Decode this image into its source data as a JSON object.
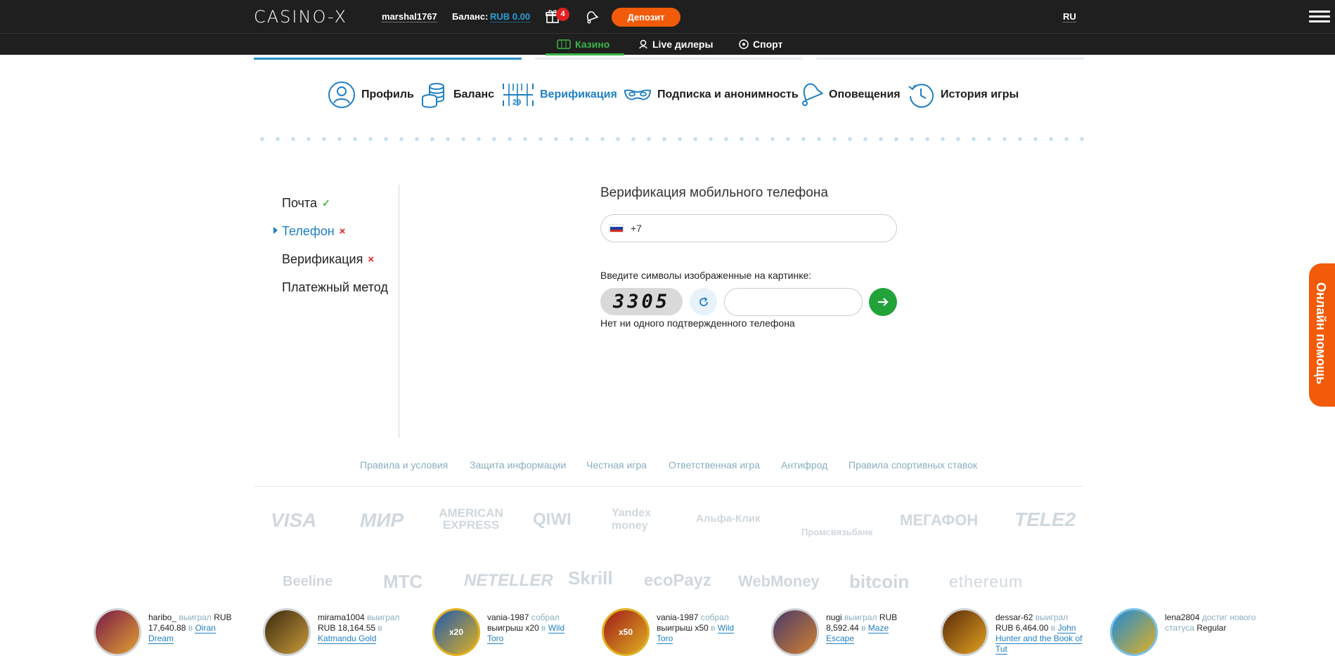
{
  "header": {
    "logo": "CASINO-X",
    "username": "marshal1767",
    "balance_label": "Баланс:",
    "balance_value": "RUB 0.00",
    "gift_count": "4",
    "deposit_label": "Депозит",
    "language": "RU"
  },
  "subnav": {
    "items": [
      {
        "label": "Казино",
        "icon": "slot-icon",
        "active": true
      },
      {
        "label": "Live дилеры",
        "icon": "dealer-icon",
        "active": false
      },
      {
        "label": "Спорт",
        "icon": "ball-icon",
        "active": false
      }
    ]
  },
  "profile_tabs": [
    {
      "label": "Профиль",
      "icon": "profile-icon",
      "active": false
    },
    {
      "label": "Баланс",
      "icon": "coins-icon",
      "active": false
    },
    {
      "label": "Верификация",
      "icon": "verification-icon",
      "active": true
    },
    {
      "label": "Подписка и анонимность",
      "icon": "mask-icon",
      "active": false
    },
    {
      "label": "Оповещения",
      "icon": "bell-icon",
      "active": false
    },
    {
      "label": "История игры",
      "icon": "history-icon",
      "active": false
    }
  ],
  "side_menu": [
    {
      "label": "Почта",
      "status": "✓"
    },
    {
      "label": "Телефон",
      "status": "×"
    },
    {
      "label": "Верификация",
      "status": "×"
    },
    {
      "label": "Платежный метод",
      "status": ""
    }
  ],
  "form": {
    "title": "Верификация мобильного телефона",
    "phone_prefix": "+7",
    "captcha_label": "Введите символы изображенные на картинке:",
    "captcha_text": "3305",
    "captcha_value": "",
    "status_text": "Нет ни одного подтвержденного телефона"
  },
  "help_label": "Онлайн помощь",
  "footer": {
    "links": [
      "Правила и условия",
      "Защита информации",
      "Честная игра",
      "Ответственная игра",
      "Антифрод",
      "Правила спортивных ставок"
    ],
    "payment_row1": [
      "VISA",
      "МИР",
      "AMERICAN EXPRESS",
      "QIWI",
      "Yandex money",
      "Альфа-Клик",
      "Промсвязьбанк",
      "МЕГАФОН",
      "TELE2"
    ],
    "payment_row2": [
      "Beeline",
      "МТС",
      "NETELLER",
      "Skrill",
      "ecoPayz",
      "WebMoney",
      "bitcoin",
      "ethereum"
    ]
  },
  "winners": [
    {
      "user": "haribo_",
      "action": "выиграл",
      "amount": "RUB 17,640.88",
      "prep": "в",
      "game": "Oiran Dream"
    },
    {
      "user": "mirama1004",
      "action": "выиграл",
      "amount": "RUB 18,164.55",
      "prep": "в",
      "game": "Katmandu Gold"
    },
    {
      "user": "vania-1987",
      "action": "собрал",
      "amount": "выигрыш x20",
      "prep": "в",
      "game": "Wild Toro"
    },
    {
      "user": "vania-1987",
      "action": "собрал",
      "amount": "выигрыш x50",
      "prep": "в",
      "game": "Wild Toro"
    },
    {
      "user": "nugi",
      "action": "выиграл",
      "amount": "RUB 8,592.44",
      "prep": "в",
      "game": "Maze Escape"
    },
    {
      "user": "dessar-62",
      "action": "выиграл",
      "amount": "RUB 6,464.00",
      "prep": "в",
      "game": "John Hunter and the Book of Tut"
    },
    {
      "user": "lena2804",
      "action": "достиг нового статуса",
      "amount": "Regular",
      "prep": "",
      "game": ""
    }
  ],
  "winner_badges": [
    "",
    "",
    "x20",
    "x50",
    "",
    "",
    ""
  ]
}
